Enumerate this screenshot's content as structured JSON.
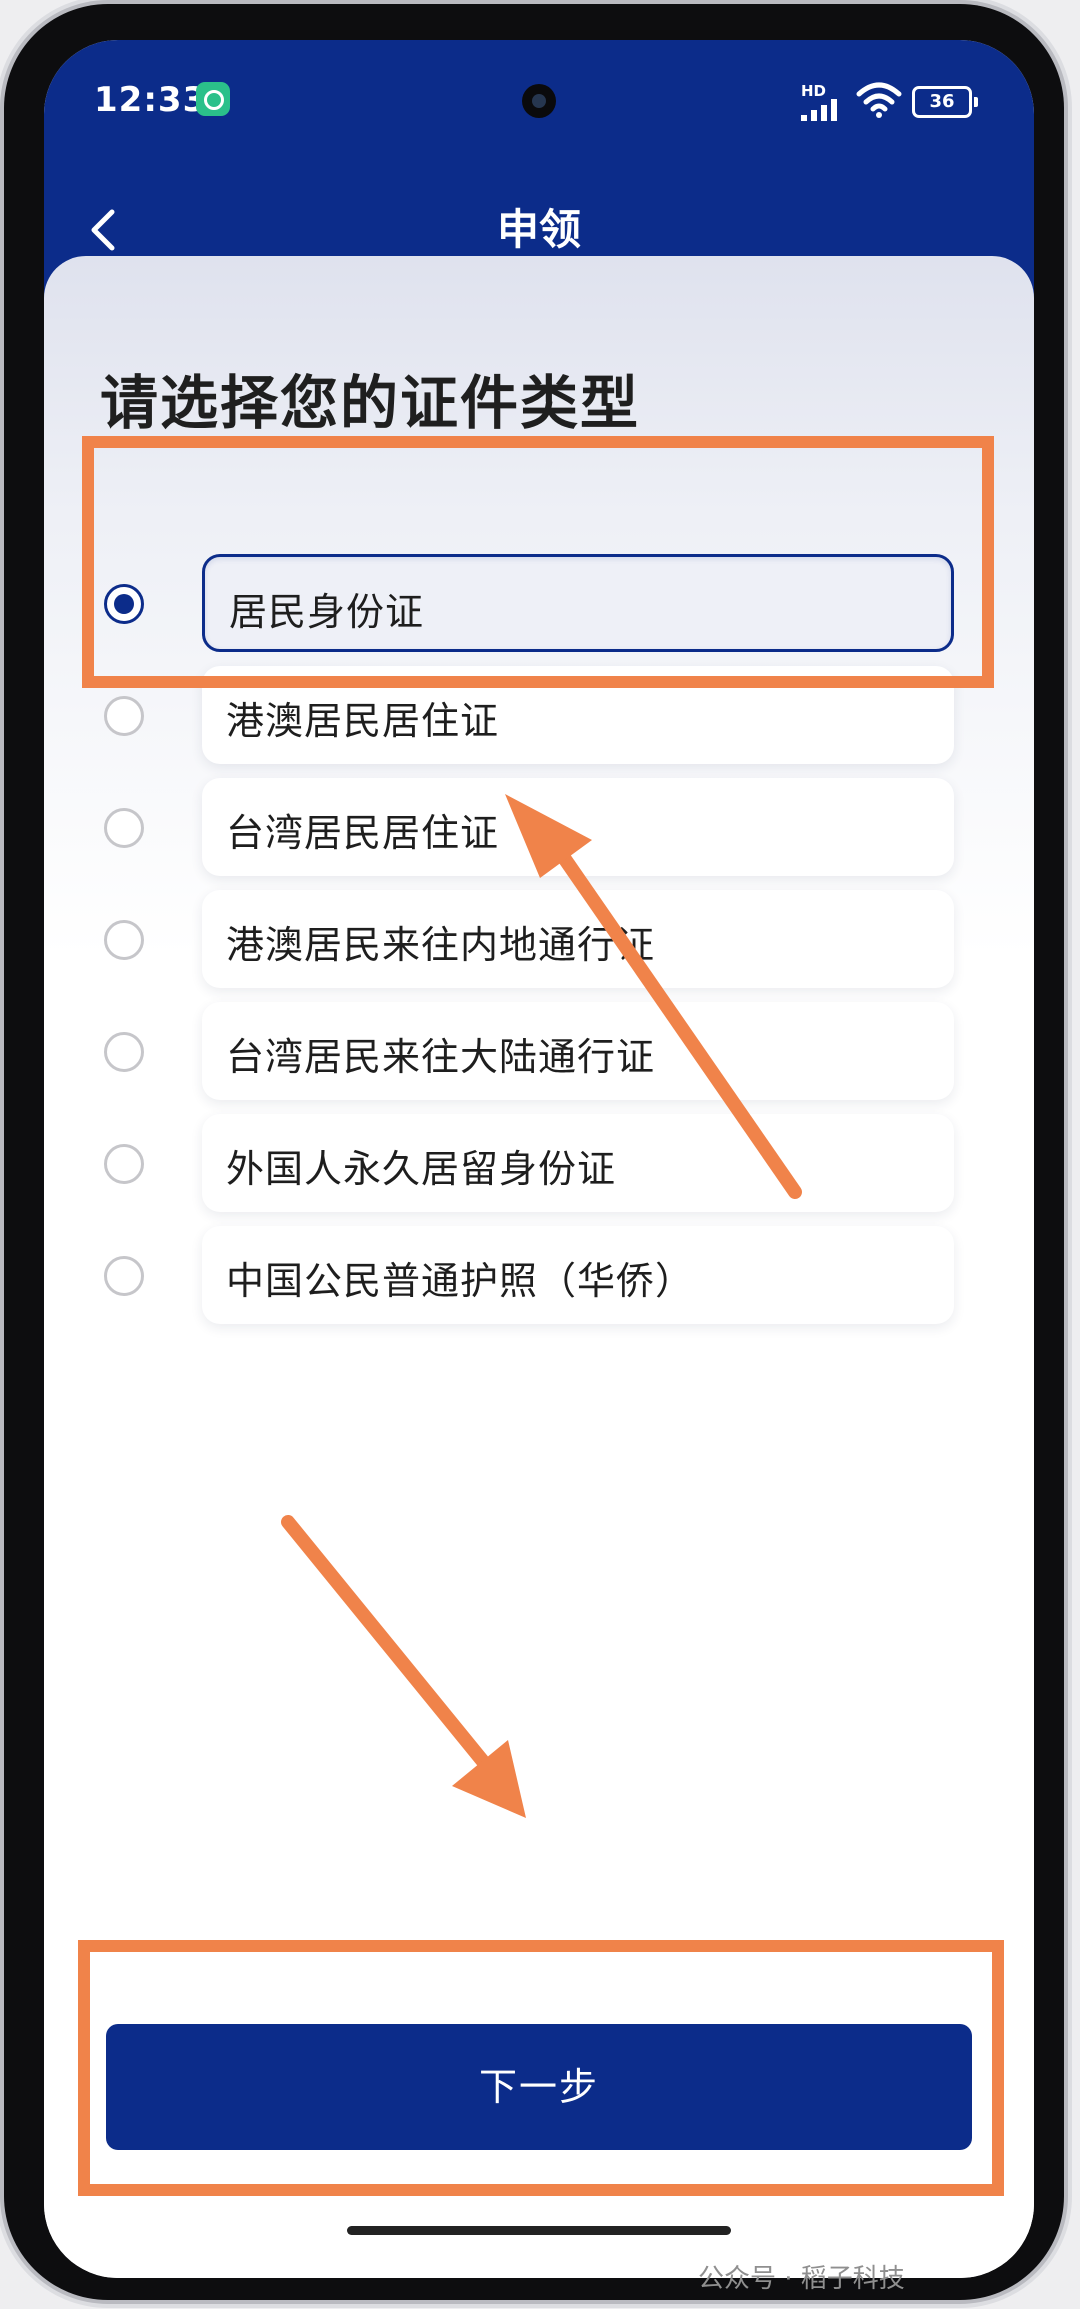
{
  "status_bar": {
    "time": "12:33",
    "network_label": "HD",
    "battery_level": "36"
  },
  "nav": {
    "title": "申领"
  },
  "page": {
    "heading": "请选择您的证件类型"
  },
  "options": [
    {
      "label": "居民身份证",
      "selected": true
    },
    {
      "label": "港澳居民居住证",
      "selected": false
    },
    {
      "label": "台湾居民居住证",
      "selected": false
    },
    {
      "label": "港澳居民来往内地通行证",
      "selected": false
    },
    {
      "label": "台湾居民来往大陆通行证",
      "selected": false
    },
    {
      "label": "外国人永久居留身份证",
      "selected": false
    },
    {
      "label": "中国公民普通护照（华侨）",
      "selected": false
    }
  ],
  "actions": {
    "next_label": "下一步"
  },
  "watermark": {
    "text": "公众号 · 稻子科技"
  },
  "colors": {
    "brand_blue": "#0c2c8a",
    "highlight_orange": "#f0834a"
  }
}
